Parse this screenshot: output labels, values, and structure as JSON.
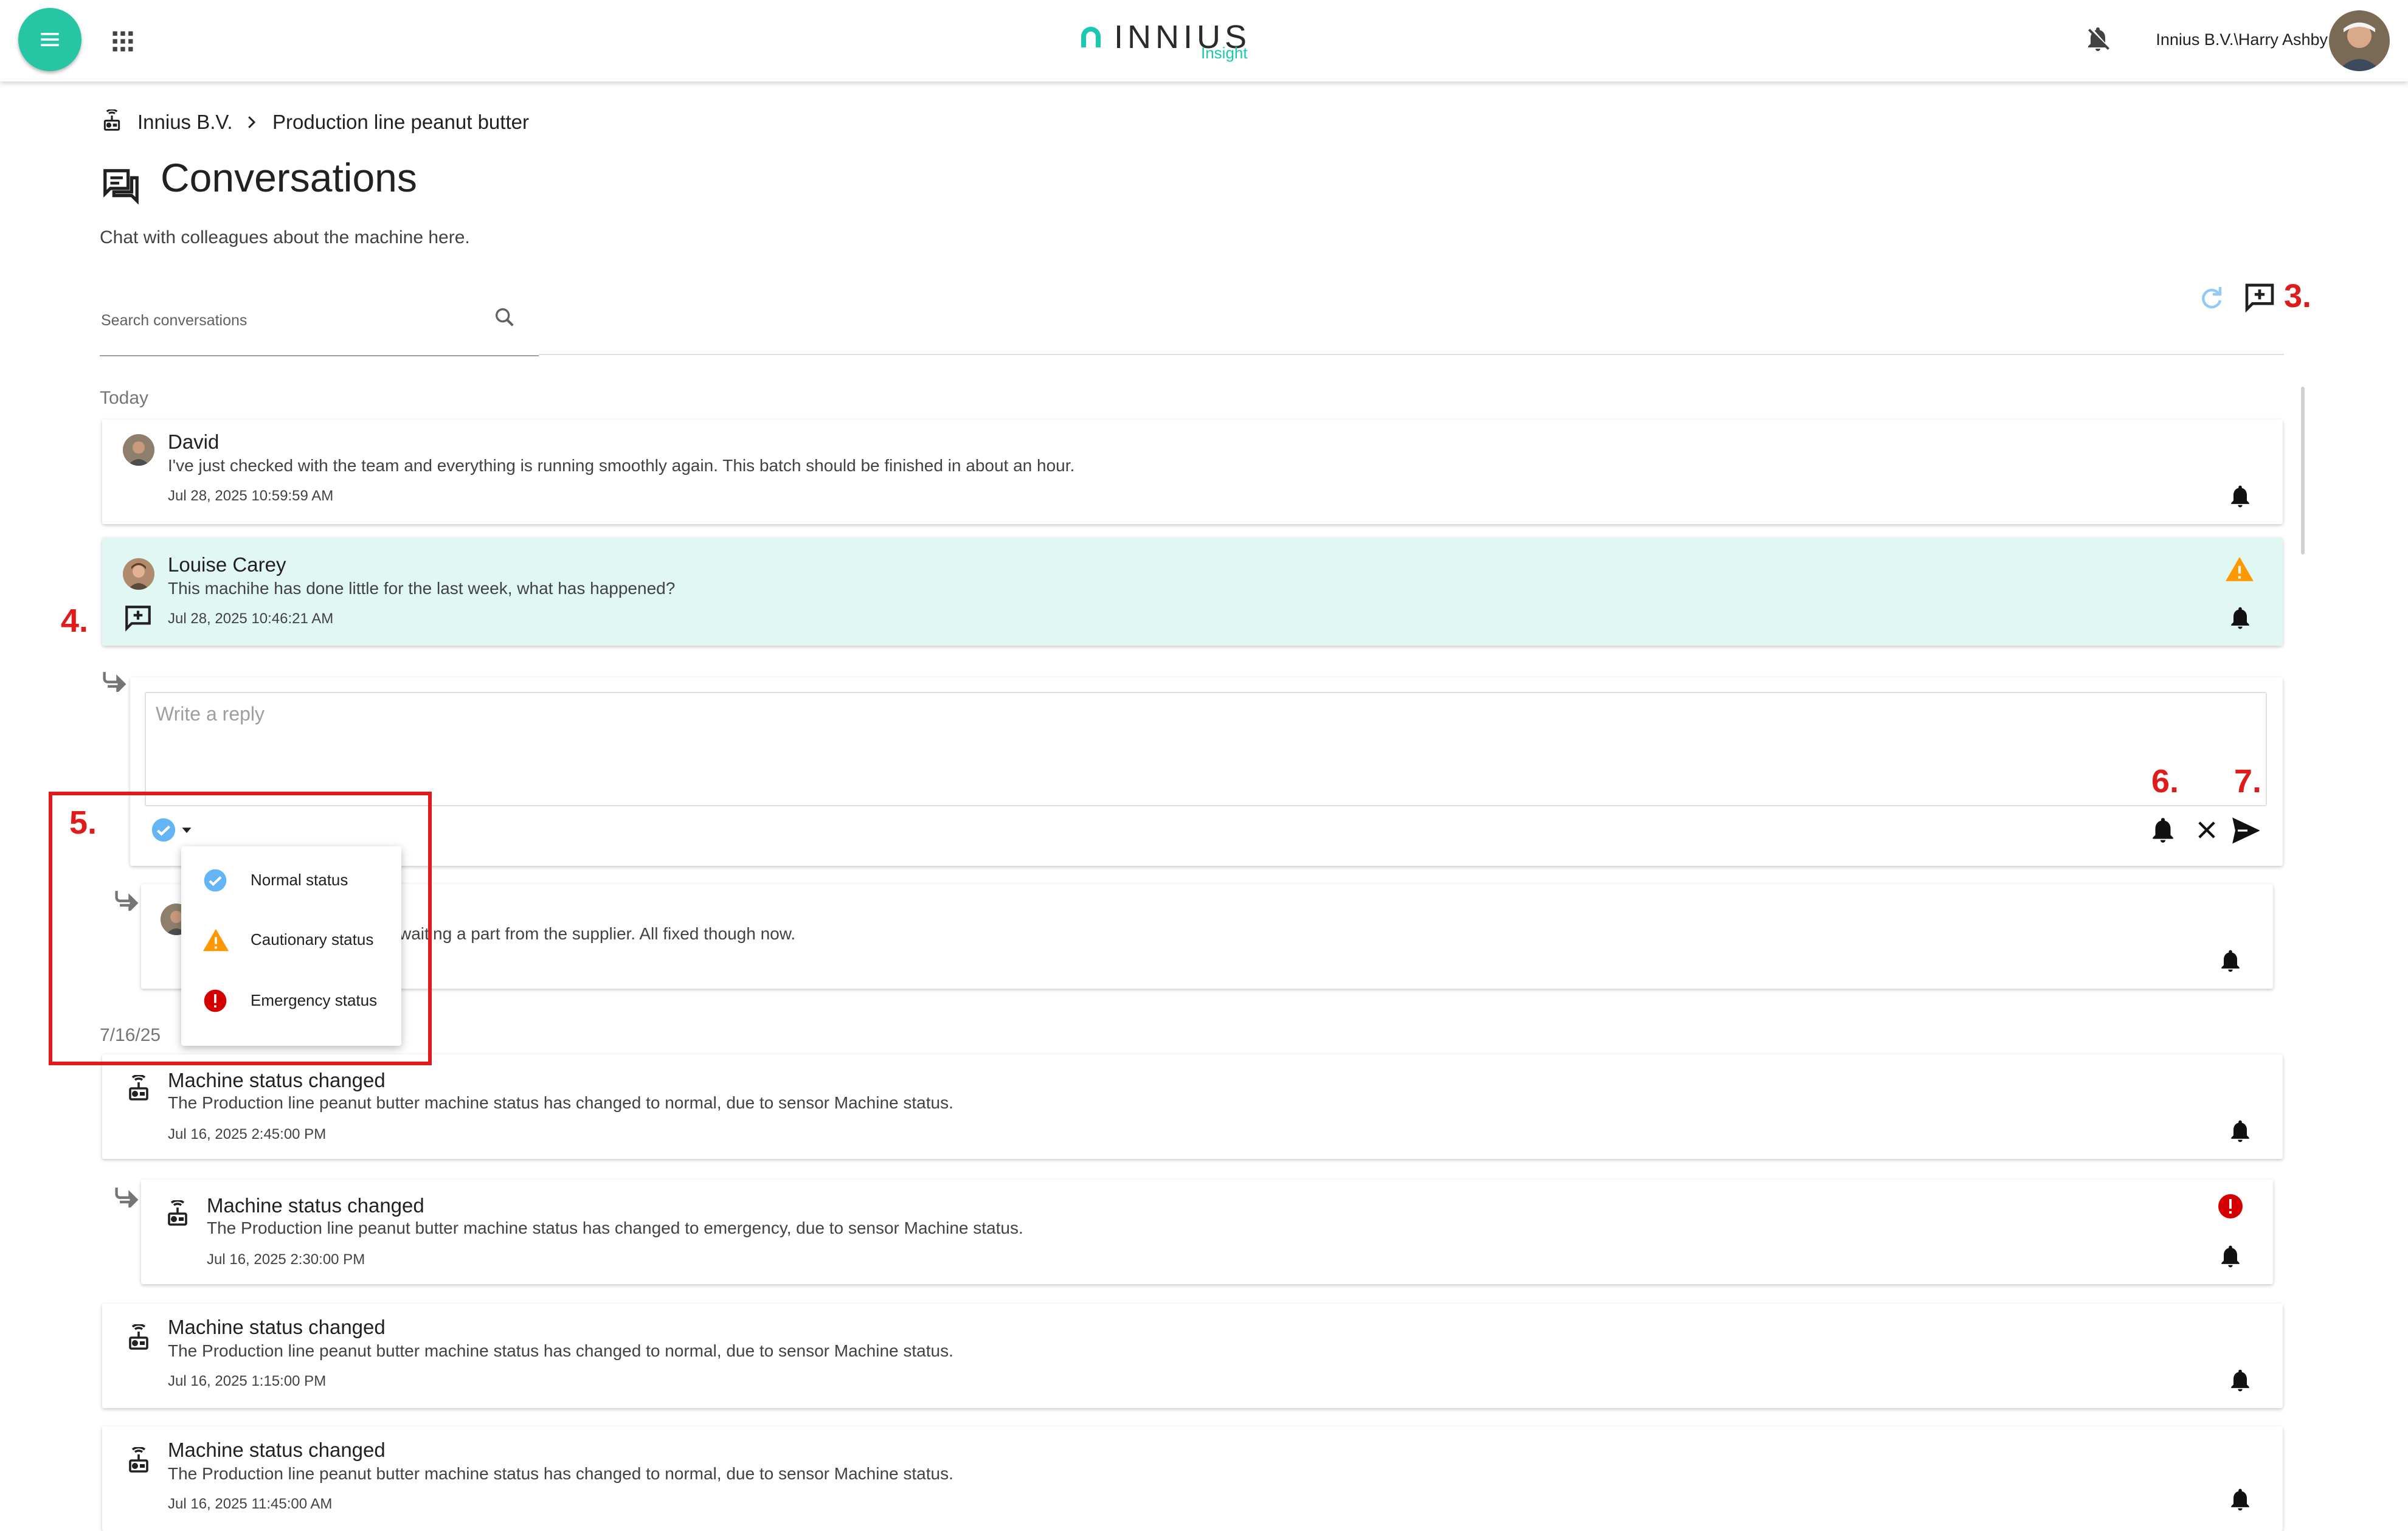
{
  "header": {
    "logo_word": "INNIUS",
    "logo_sub": "Insight",
    "user": "Innius B.V.\\Harry Ashby"
  },
  "breadcrumb": {
    "items": [
      "Innius B.V.",
      "Production line peanut butter"
    ]
  },
  "page": {
    "title": "Conversations",
    "subtitle": "Chat with colleagues about the machine here."
  },
  "search": {
    "placeholder": "Search conversations"
  },
  "annotations": {
    "a3": "3.",
    "a4": "4.",
    "a5": "5.",
    "a6": "6.",
    "a7": "7."
  },
  "groups": {
    "today": "Today",
    "older": "7/16/25"
  },
  "messages": [
    {
      "name": "David",
      "text": "I've just checked with the team and everything is running smoothly again. This batch should be finished in about an hour.",
      "time": "Jul 28, 2025 10:59:59 AM"
    },
    {
      "name": "Louise Carey",
      "text": "This machihe has done little for the last week, what has happened?",
      "time": "Jul 28, 2025 10:46:21 AM",
      "status": "cautionary"
    },
    {
      "text_partial": "waiting a part from the supplier. All fixed though now."
    },
    {
      "name": "Machine status changed",
      "text": "The Production line peanut butter machine status has changed to normal, due to sensor Machine status.",
      "time": "Jul 16, 2025 2:45:00 PM"
    },
    {
      "name": "Machine status changed",
      "text": "The Production line peanut butter machine status has changed to emergency, due to sensor Machine status.",
      "time": "Jul 16, 2025 2:30:00 PM",
      "status": "emergency"
    },
    {
      "name": "Machine status changed",
      "text": "The Production line peanut butter machine status has changed to normal, due to sensor Machine status.",
      "time": "Jul 16, 2025 1:15:00 PM"
    },
    {
      "name": "Machine status changed",
      "text": "The Production line peanut butter machine status has changed to normal, due to sensor Machine status.",
      "time": "Jul 16, 2025 11:45:00 AM"
    }
  ],
  "reply": {
    "placeholder": "Write a reply"
  },
  "status_menu": {
    "items": [
      "Normal status",
      "Cautionary status",
      "Emergency status"
    ]
  },
  "colors": {
    "accent": "#26c6a4",
    "highlight_row": "#e0f7f3",
    "normal": "#64b5f6",
    "cautionary": "#ff9800",
    "emergency": "#d50000",
    "annotation": "#e01b1b"
  }
}
